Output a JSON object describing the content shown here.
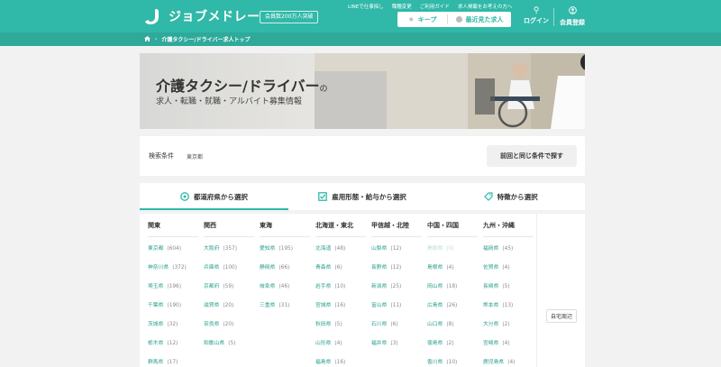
{
  "header": {
    "logo_text": "ジョブメドレー",
    "member_badge": "会員数200万人突破",
    "top_links": [
      "LINEで仕事探し",
      "職種変更",
      "ご利用ガイド",
      "求人掲載をお考えの方へ"
    ],
    "keep_label": "キープ",
    "recent_label": "最近見た求人",
    "login_label": "ログイン",
    "register_label": "会員登録"
  },
  "breadcrumb": {
    "current": "介護タクシー/ドライバー求人トップ"
  },
  "hero": {
    "title_main": "介護タクシー/ドライバー",
    "title_suffix": "の",
    "subtitle": "求人・転職・就職・アルバイト募集情報"
  },
  "search": {
    "label": "検索条件",
    "value": "東京都",
    "again_button": "前回と同じ条件で探す"
  },
  "tabs": [
    {
      "label": "都道府県から選択",
      "icon": "map-pin-icon",
      "active": true
    },
    {
      "label": "雇用形態・給与から選択",
      "icon": "checkbox-icon",
      "active": false
    },
    {
      "label": "特徴から選択",
      "icon": "tag-icon",
      "active": false
    }
  ],
  "regions": [
    {
      "name": "関東",
      "prefs": [
        {
          "name": "東京都",
          "count": "(604)"
        },
        {
          "name": "神奈川県",
          "count": "(372)"
        },
        {
          "name": "埼玉県",
          "count": "(196)"
        },
        {
          "name": "千葉県",
          "count": "(190)"
        },
        {
          "name": "茨城県",
          "count": "(32)"
        },
        {
          "name": "栃木県",
          "count": "(12)"
        },
        {
          "name": "群馬県",
          "count": "(17)"
        }
      ]
    },
    {
      "name": "関西",
      "prefs": [
        {
          "name": "大阪府",
          "count": "(357)"
        },
        {
          "name": "兵庫県",
          "count": "(100)"
        },
        {
          "name": "京都府",
          "count": "(59)"
        },
        {
          "name": "滋賀県",
          "count": "(20)"
        },
        {
          "name": "奈良県",
          "count": "(20)"
        },
        {
          "name": "和歌山県",
          "count": "(5)"
        }
      ]
    },
    {
      "name": "東海",
      "prefs": [
        {
          "name": "愛知県",
          "count": "(195)"
        },
        {
          "name": "静岡県",
          "count": "(66)"
        },
        {
          "name": "岐阜県",
          "count": "(46)"
        },
        {
          "name": "三重県",
          "count": "(31)"
        }
      ]
    },
    {
      "name": "北海道・東北",
      "prefs": [
        {
          "name": "北海道",
          "count": "(48)"
        },
        {
          "name": "青森県",
          "count": "(6)"
        },
        {
          "name": "岩手県",
          "count": "(10)"
        },
        {
          "name": "宮城県",
          "count": "(16)"
        },
        {
          "name": "秋田県",
          "count": "(5)"
        },
        {
          "name": "山形県",
          "count": "(4)"
        },
        {
          "name": "福島県",
          "count": "(16)"
        }
      ]
    },
    {
      "name": "甲信越・北陸",
      "prefs": [
        {
          "name": "山梨県",
          "count": "(12)"
        },
        {
          "name": "長野県",
          "count": "(12)"
        },
        {
          "name": "新潟県",
          "count": "(25)"
        },
        {
          "name": "富山県",
          "count": "(11)"
        },
        {
          "name": "石川県",
          "count": "(6)"
        },
        {
          "name": "福井県",
          "count": "(3)"
        }
      ]
    },
    {
      "name": "中国・四国",
      "prefs": [
        {
          "name": "鳥取県",
          "count": "(0)",
          "dim": true
        },
        {
          "name": "島根県",
          "count": "(4)"
        },
        {
          "name": "岡山県",
          "count": "(18)"
        },
        {
          "name": "広島県",
          "count": "(26)"
        },
        {
          "name": "山口県",
          "count": "(8)"
        },
        {
          "name": "徳島県",
          "count": "(2)"
        },
        {
          "name": "香川県",
          "count": "(10)"
        }
      ]
    },
    {
      "name": "九州・沖縄",
      "prefs": [
        {
          "name": "福岡県",
          "count": "(45)"
        },
        {
          "name": "佐賀県",
          "count": "(4)"
        },
        {
          "name": "長崎県",
          "count": "(5)"
        },
        {
          "name": "熊本県",
          "count": "(13)"
        },
        {
          "name": "大分県",
          "count": "(2)"
        },
        {
          "name": "宮崎県",
          "count": "(4)"
        },
        {
          "name": "鹿児島県",
          "count": "(4)"
        }
      ]
    }
  ],
  "home_button": "自宅周辺",
  "colors": {
    "brand": "#30b8a8",
    "link": "#2aa090"
  }
}
